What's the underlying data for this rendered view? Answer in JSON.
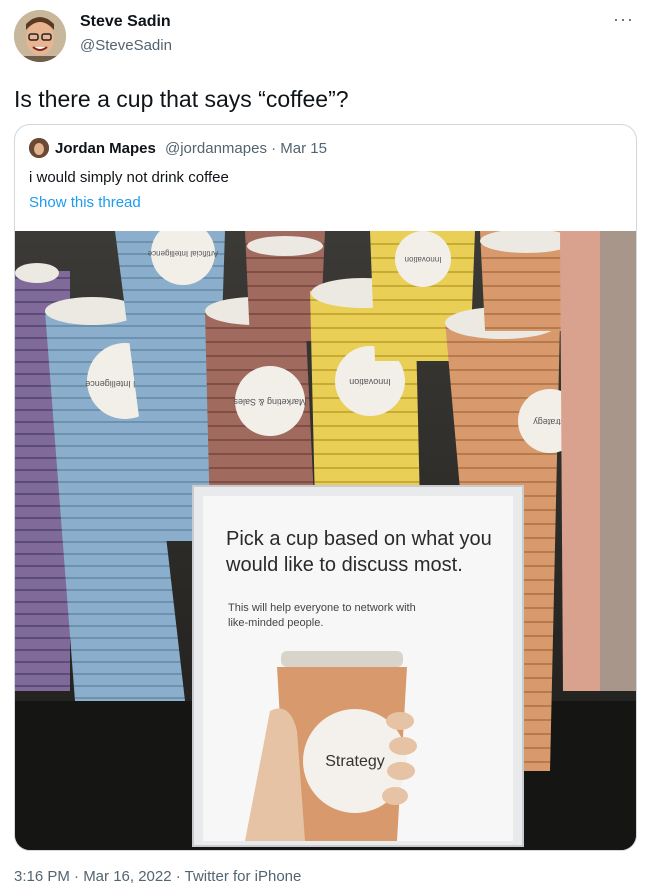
{
  "author": {
    "name": "Steve Sadin",
    "handle": "@SteveSadin",
    "more_icon": "more-dots-icon"
  },
  "tweet": {
    "text": "Is there a cup that says “coffee”?",
    "timestamp": "3:16 PM · Mar 16, 2022 · Twitter for iPhone"
  },
  "quote": {
    "name": "Jordan Mapes",
    "meta": "@jordanmapes · Mar 15",
    "text": "i would simply not drink coffee",
    "thread_link": "Show this thread",
    "photo": {
      "sign_heading_line1": "Pick a cup based on what you",
      "sign_heading_line2": "would like to discuss most.",
      "sign_body_line1": "This will help everyone to network with",
      "sign_body_line2": "like-minded people.",
      "held_cup_label": "Strategy",
      "cup_labels": [
        "Artificial Intelligence",
        "Marketing & Sales",
        "Innovation",
        "Strategy"
      ]
    }
  },
  "colors": {
    "link": "#1d9bf0",
    "secondary_text": "#536471",
    "border": "#cfd9de",
    "cup_blue": "#8aaecb",
    "cup_purple": "#7f6a9a",
    "cup_brown": "#a06a5e",
    "cup_yellow": "#e9cf55",
    "cup_orange": "#d89a6c"
  }
}
